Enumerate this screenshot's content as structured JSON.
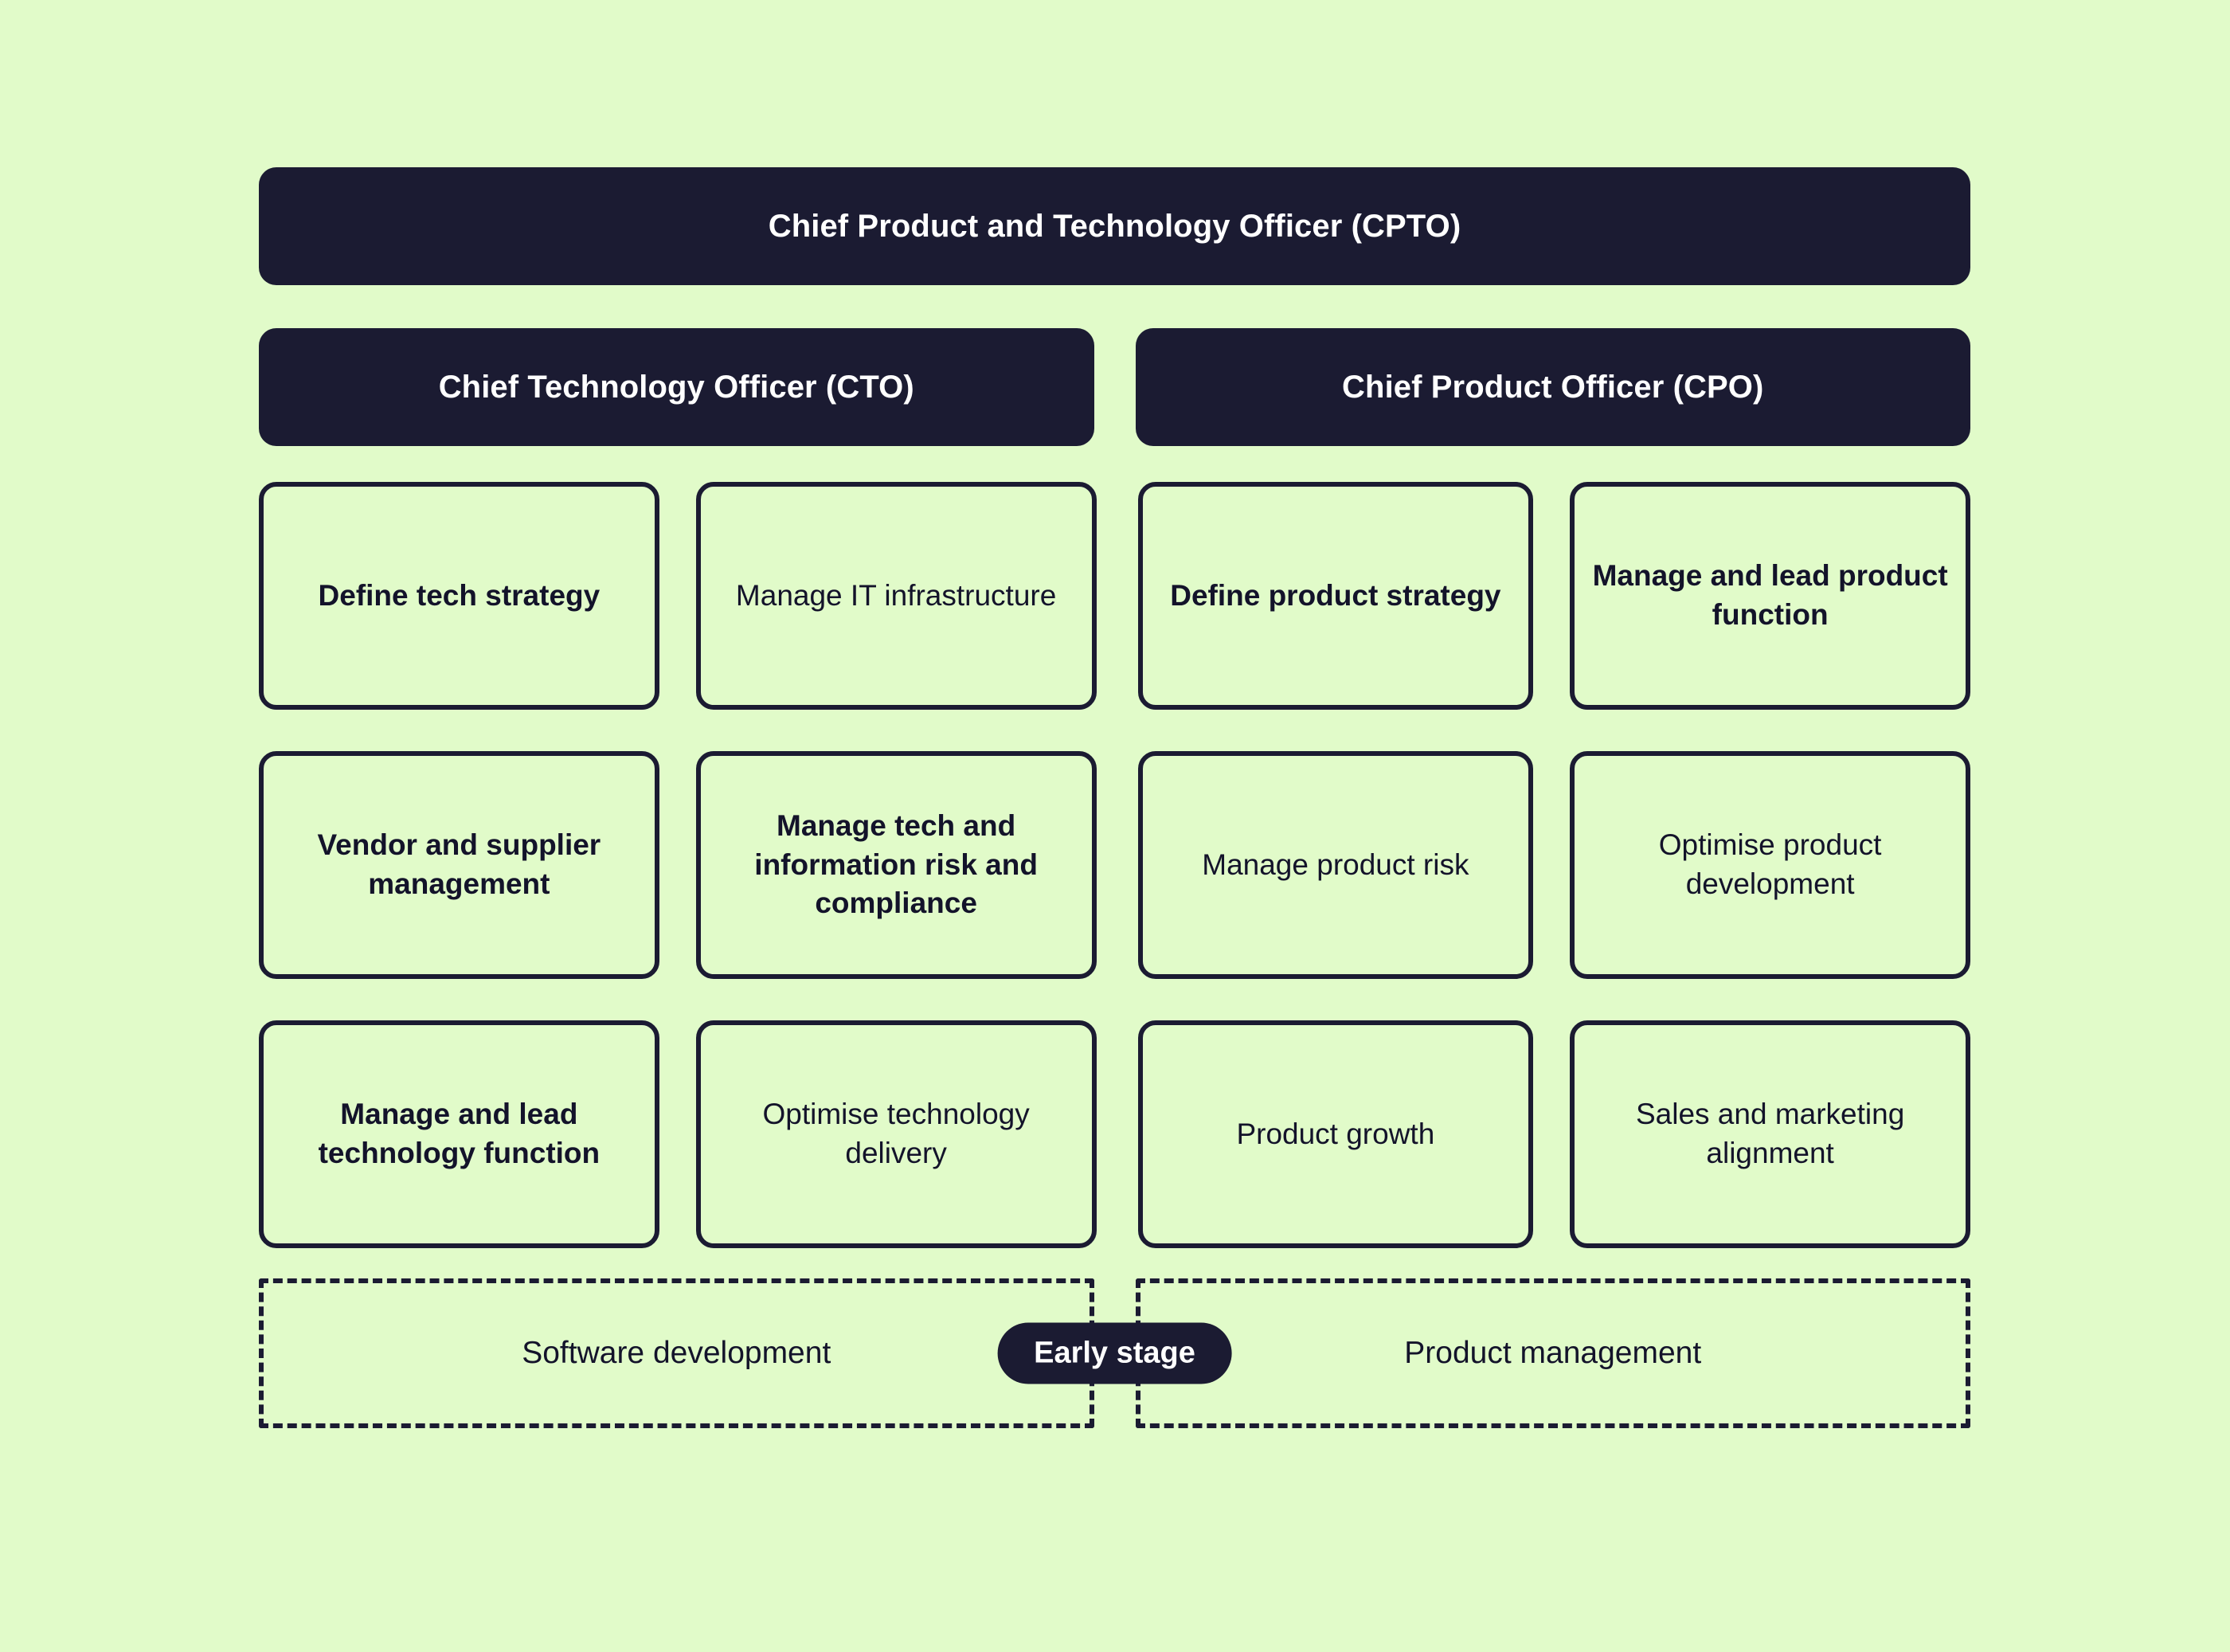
{
  "diagram": {
    "title": "Chief Product and Technology Officer (CPTO)",
    "top_level": {
      "label": "Chief Product and Technology Officer (CPTO)"
    },
    "officers": [
      {
        "label": "Chief Technology Officer (CTO)"
      },
      {
        "label": "Chief Product Officer (CPO)"
      }
    ],
    "duties": [
      {
        "label": "Define tech strategy",
        "column": "cto",
        "row": 1
      },
      {
        "label": "Manage\nIT infrastructure",
        "column": "cto",
        "row": 1
      },
      {
        "label": "Define product strategy",
        "column": "cpo",
        "row": 1
      },
      {
        "label": "Manage and lead product function",
        "column": "cpo",
        "row": 1
      },
      {
        "label": "Vendor and supplier management",
        "column": "cto",
        "row": 2
      },
      {
        "label": "Manage tech and information risk and compliance",
        "column": "cto",
        "row": 2
      },
      {
        "label": "Manage product risk",
        "column": "cpo",
        "row": 2
      },
      {
        "label": "Optimise product development",
        "column": "cpo",
        "row": 2
      },
      {
        "label": "Manage and lead technology function",
        "column": "cto",
        "row": 3
      },
      {
        "label": "Optimise technology delivery",
        "column": "cto",
        "row": 3
      },
      {
        "label": "Product growth",
        "column": "cpo",
        "row": 3
      },
      {
        "label": "Sales and marketing alignment",
        "column": "cpo",
        "row": 3
      }
    ],
    "stage_band": {
      "left_zone_label": "Software development",
      "right_zone_label": "Product management",
      "pill_label": "Early stage"
    },
    "colors": {
      "background": "#e1fbc9",
      "dark": "#1b1b32",
      "card_text": "#13132a",
      "on_dark_text": "#ffffff"
    }
  }
}
